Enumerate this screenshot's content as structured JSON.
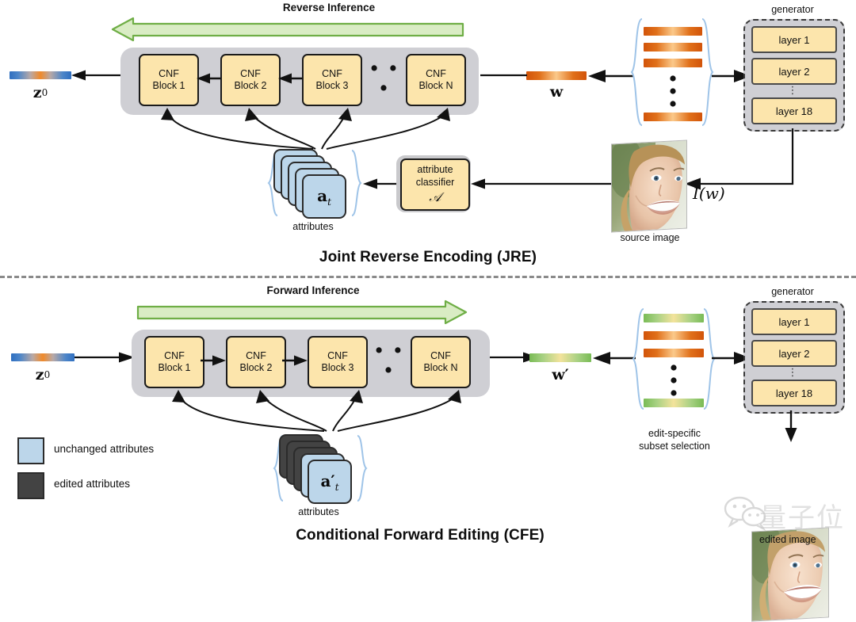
{
  "top": {
    "title": "Joint Reverse Encoding (JRE)",
    "inference_label": "Reverse Inference",
    "arrow_direction": "left",
    "latent_label": "z",
    "latent_sub": "0",
    "w_label": "w",
    "cnf_blocks": [
      {
        "line1": "CNF",
        "line2": "Block 1"
      },
      {
        "line1": "CNF",
        "line2": "Block 2"
      },
      {
        "line1": "CNF",
        "line2": "Block 3"
      },
      {
        "line1": "CNF",
        "line2": "Block N"
      }
    ],
    "ellipsis": "• • •",
    "attributes": {
      "label": "attributes",
      "symbol": "a",
      "symbol_sub": "t",
      "light_count": 5,
      "dark_count": 0
    },
    "classifier": {
      "line1": "attribute",
      "line2": "classifier",
      "symbol": "𝒜"
    },
    "generator": {
      "label": "generator",
      "layers": [
        "layer 1",
        "layer 2",
        "layer 18"
      ],
      "ellipsis": "⋮"
    },
    "image_fn": "I(w)",
    "image_caption": "source image"
  },
  "bottom": {
    "title": "Conditional Forward Editing (CFE)",
    "inference_label": "Forward Inference",
    "arrow_direction": "right",
    "latent_label": "z",
    "latent_sub": "0",
    "w_label": "w′",
    "cnf_blocks": [
      {
        "line1": "CNF",
        "line2": "Block 1"
      },
      {
        "line1": "CNF",
        "line2": "Block 2"
      },
      {
        "line1": "CNF",
        "line2": "Block 3"
      },
      {
        "line1": "CNF",
        "line2": "Block N"
      }
    ],
    "ellipsis": "• • •",
    "attributes": {
      "label": "attributes",
      "symbol": "a′",
      "symbol_sub": "t",
      "light_count": 2,
      "dark_count": 3
    },
    "subset_label_line1": "edit-specific",
    "subset_label_line2": "subset selection",
    "generator": {
      "label": "generator",
      "layers": [
        "layer 1",
        "layer 2",
        "layer 18"
      ],
      "ellipsis": "⋮"
    },
    "image_caption": "edited image"
  },
  "legend": [
    {
      "label": "unchanged attributes",
      "color": "#bcd6ea"
    },
    {
      "label": "edited attributes",
      "color": "#434343"
    }
  ],
  "watermark": {
    "text": "量子位"
  },
  "colors": {
    "cnf_fill": "#fce5ac",
    "container_gray": "#cfcfd4",
    "green_arrow_fill": "#d9ecc4",
    "green_arrow_stroke": "#6fae46",
    "attr_light": "#bcd6ea",
    "attr_dark": "#434343",
    "brace_blue": "#9fc4e8",
    "orange": "#d2540a",
    "green": "#79bb55"
  }
}
